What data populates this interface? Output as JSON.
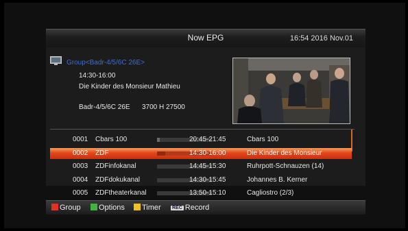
{
  "header": {
    "title": "Now EPG",
    "clock": "16:54 2016 Nov.01"
  },
  "info": {
    "group_label": "Group<Badr-4/5/6C 26E>",
    "time": "14:30-16:00",
    "program": "Die Kinder des Monsieur Mathieu",
    "satellite": "Badr-4/5/6C 26E",
    "transponder": "3700 H 27500"
  },
  "channels": [
    {
      "num": "0001",
      "name": "Cbars 100",
      "time": "20:45-21:45",
      "program": "Cbars 100",
      "progress": 0.05
    },
    {
      "num": "0002",
      "name": "ZDF",
      "time": "14:30-16:00",
      "program": "Die Kinder des Monsieur",
      "progress": 0.15
    },
    {
      "num": "0003",
      "name": "ZDFinfokanal",
      "time": "14:45-15:30",
      "program": "Ruhrpott-Schnauzen (14)",
      "progress": 0.0
    },
    {
      "num": "0004",
      "name": "ZDFdokukanal",
      "time": "14:30-15:45",
      "program": "Johannes B. Kerner",
      "progress": 0.0
    },
    {
      "num": "0005",
      "name": "ZDFtheaterkanal",
      "time": "13:50-15:10",
      "program": "Cagliostro (2/3)",
      "progress": 0.0
    }
  ],
  "selected_index": 1,
  "footer": {
    "red_label": "Group",
    "green_label": "Options",
    "yellow_label": "Timer",
    "rec_key": "REC",
    "rec_label": "Record"
  },
  "colors": {
    "red": "#e53020",
    "green": "#3fb43f",
    "yellow": "#f0c020",
    "accent": "#e2461a"
  }
}
